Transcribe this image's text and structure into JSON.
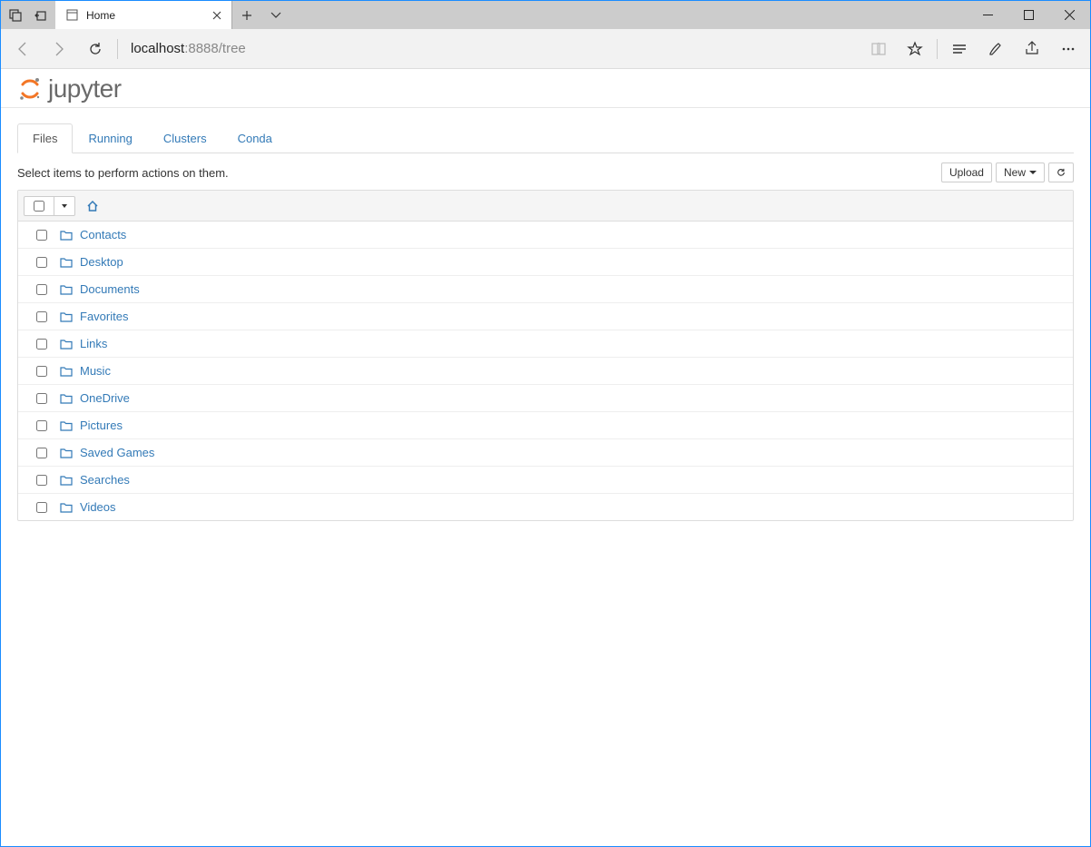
{
  "browser": {
    "tab_title": "Home",
    "address_host": "localhost",
    "address_path": ":8888/tree"
  },
  "header": {
    "logo_text": "jupyter"
  },
  "tabs": [
    {
      "label": "Files",
      "active": true
    },
    {
      "label": "Running",
      "active": false
    },
    {
      "label": "Clusters",
      "active": false
    },
    {
      "label": "Conda",
      "active": false
    }
  ],
  "hint": "Select items to perform actions on them.",
  "buttons": {
    "upload": "Upload",
    "new": "New"
  },
  "items": [
    {
      "name": "Contacts",
      "type": "folder"
    },
    {
      "name": "Desktop",
      "type": "folder"
    },
    {
      "name": "Documents",
      "type": "folder"
    },
    {
      "name": "Favorites",
      "type": "folder"
    },
    {
      "name": "Links",
      "type": "folder"
    },
    {
      "name": "Music",
      "type": "folder"
    },
    {
      "name": "OneDrive",
      "type": "folder"
    },
    {
      "name": "Pictures",
      "type": "folder"
    },
    {
      "name": "Saved Games",
      "type": "folder"
    },
    {
      "name": "Searches",
      "type": "folder"
    },
    {
      "name": "Videos",
      "type": "folder"
    }
  ]
}
